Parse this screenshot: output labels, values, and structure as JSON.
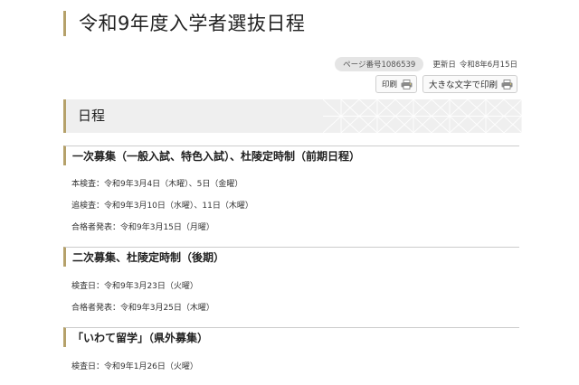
{
  "page": {
    "title": "令和9年度入学者選抜日程",
    "page_number": "ページ番号1086539",
    "updated_label": "更新日",
    "updated_date": "令和8年6月15日"
  },
  "tools": {
    "print_label": "印刷",
    "large_print_label": "大きな文字で印刷",
    "icon": "printer-icon"
  },
  "section": {
    "heading": "日程"
  },
  "schedules": [
    {
      "heading": "一次募集（一般入試、特色入試）、杜陵定時制（前期日程）",
      "lines": [
        "本検査：令和9年3月4日（木曜）、5日（金曜）",
        "追検査：令和9年3月10日（水曜）、11日（木曜）",
        "合格者発表：令和9年3月15日（月曜）"
      ]
    },
    {
      "heading": "二次募集、杜陵定時制（後期）",
      "lines": [
        "検査日：令和9年3月23日（火曜）",
        "合格者発表：令和9年3月25日（木曜）"
      ]
    },
    {
      "heading": "「いわて留学」（県外募集）",
      "lines": [
        "検査日：令和9年1月26日（火曜）"
      ]
    }
  ]
}
